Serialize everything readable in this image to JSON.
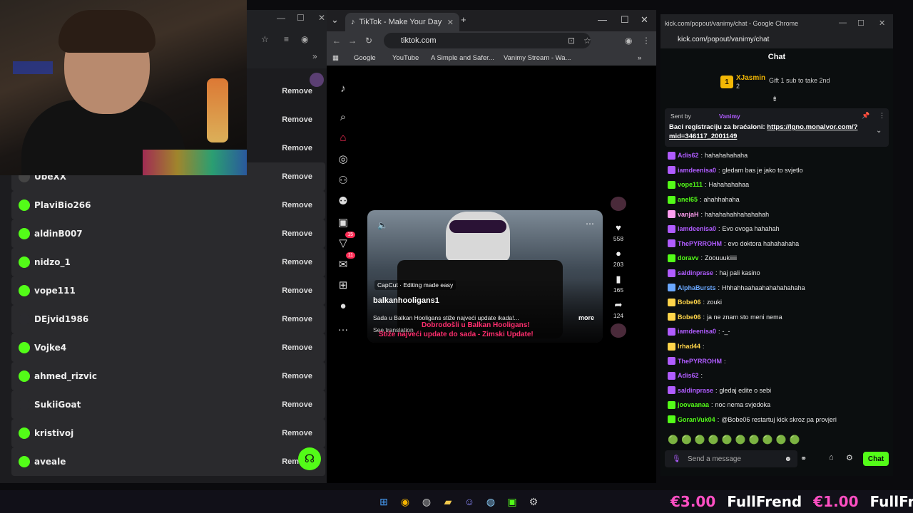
{
  "left_list": {
    "rows": [
      {
        "name": "",
        "action": "Remove"
      },
      {
        "name": "",
        "action": "Remove"
      },
      {
        "name": "",
        "action": "Remove"
      },
      {
        "name": "UbeXX",
        "action": "Remove"
      },
      {
        "name": "PlaviBio266",
        "action": "Remove"
      },
      {
        "name": "aldinB007",
        "action": "Remove"
      },
      {
        "name": "nidzo_1",
        "action": "Remove"
      },
      {
        "name": "vope111",
        "action": "Remove"
      },
      {
        "name": "DEjvid1986",
        "action": "Remove"
      },
      {
        "name": "Vojke4",
        "action": "Remove"
      },
      {
        "name": "ahmed_rizvic",
        "action": "Remove"
      },
      {
        "name": "SukiiGoat",
        "action": "Remove"
      },
      {
        "name": "kristivoj",
        "action": "Remove"
      },
      {
        "name": "aveale",
        "action": "Remove"
      }
    ]
  },
  "tiktok": {
    "tab_title": "TikTok - Make Your Day",
    "url": "tiktok.com",
    "bookmarks": [
      "Google",
      "YouTube",
      "A Simple and Safer...",
      "Vanimy Stream - Wa..."
    ],
    "badges": {
      "activity": "15",
      "messages": "11"
    },
    "video": {
      "capcut": "CapCut · Editing made easy",
      "username": "balkanhooligans1",
      "description": "Sada u Balkan Hooligans stiže najveći update ikada!...",
      "more": "more",
      "see_translation": "See translation",
      "subtitle_1": "Dobrodošli u Balkan Hooligans!",
      "subtitle_2": "Stiže najveći update do sada - Zimski Update!"
    },
    "actions": {
      "likes": "558",
      "comments": "203",
      "saves": "165",
      "shares": "124"
    }
  },
  "chat": {
    "window_url": "kick.com/popout/vanimy/chat",
    "window_title": "kick.com/popout/vanimy/chat - Google Chrome",
    "header": "Chat",
    "leaderboard": {
      "rank": "1",
      "name": "XJasmin",
      "count": "2",
      "gift_text": "Gift 1 sub to take 2nd"
    },
    "pinned": {
      "sent_by": "Sent by",
      "sender": "Vanimy",
      "text": "Baci registraciju za braćaloni: ",
      "link": "https://lgno.monalvor.com/?mid=346117_2001149"
    },
    "messages": [
      {
        "user": "Adis62",
        "color": "#b05cff",
        "text": "hahahahahaha"
      },
      {
        "user": "iamdeenisa0",
        "color": "#b05cff",
        "text": "gledam bas je jako to svjetlo"
      },
      {
        "user": "vope111",
        "color": "#53fc18",
        "text": "Hahahahahaa"
      },
      {
        "user": "anel65",
        "color": "#53fc18",
        "text": "ahahhahaha"
      },
      {
        "user": "vanjaH",
        "color": "#ff9ef0",
        "text": "hahahahahhahahahah"
      },
      {
        "user": "iamdeenisa0",
        "color": "#b05cff",
        "text": "Evo ovoga hahahah"
      },
      {
        "user": "ThePYRROHM",
        "color": "#b05cff",
        "text": "evo doktora hahahahaha"
      },
      {
        "user": "doravv",
        "color": "#53fc18",
        "text": "Zoouuukiiiii"
      },
      {
        "user": "saldinprase",
        "color": "#b05cff",
        "text": "haj pali kasino"
      },
      {
        "user": "AlphaBursts",
        "color": "#6aa8ff",
        "text": "Hhhahhaahaahahahahahaha"
      },
      {
        "user": "Bobe06",
        "color": "#ffd54a",
        "text": "zouki"
      },
      {
        "user": "Bobe06",
        "color": "#ffd54a",
        "text": "ja ne znam sto meni nema"
      },
      {
        "user": "iamdeenisa0",
        "color": "#b05cff",
        "text": "-_-"
      },
      {
        "user": "Irhad44",
        "color": "#ffd54a",
        "text": ""
      },
      {
        "user": "ThePYRROHM",
        "color": "#b05cff",
        "text": ""
      },
      {
        "user": "Adis62",
        "color": "#b05cff",
        "text": ""
      },
      {
        "user": "saldinprase",
        "color": "#b05cff",
        "text": "gledaj edite o sebi"
      },
      {
        "user": "joovaanaa",
        "color": "#53fc18",
        "text": "noc nema svjedoka"
      },
      {
        "user": "GoranVuk04",
        "color": "#53fc18",
        "text": "@Bobe06 restartuj kick skroz pa provjeri"
      }
    ],
    "input_placeholder": "Send a message",
    "chat_button": "Chat"
  },
  "ticker": {
    "amount_1": "€3.00",
    "name_1": "FullFrend",
    "amount_2": "€1.00",
    "name_2": "FullFre"
  },
  "colors": {
    "kick_green": "#53fc18",
    "tiktok_red": "#fe2c55",
    "donation_pink": "#ff4fc3"
  }
}
